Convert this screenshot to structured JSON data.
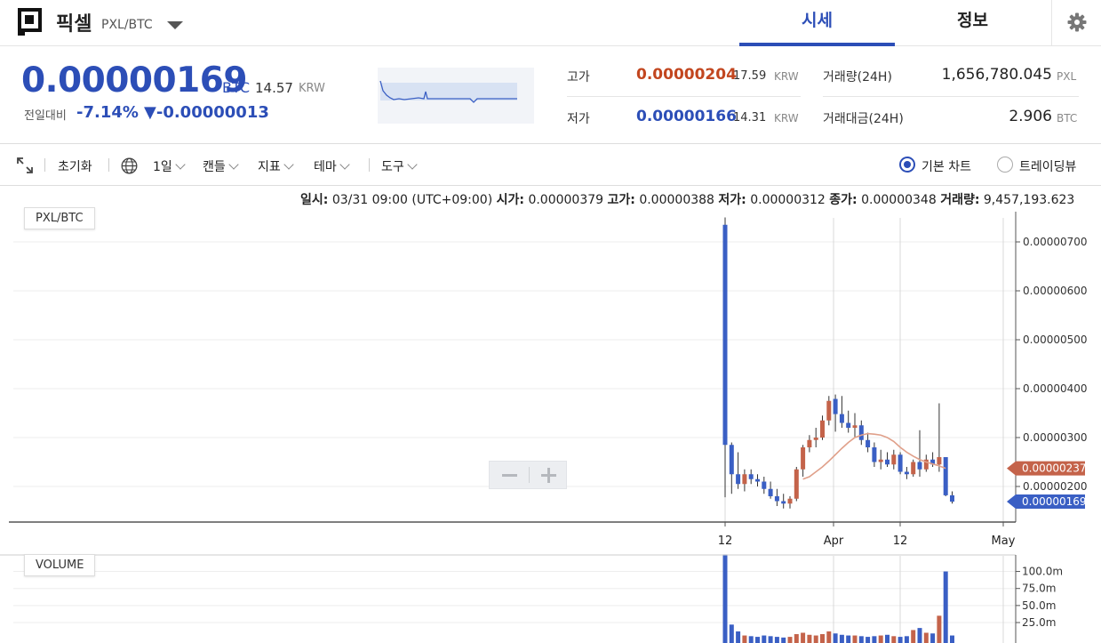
{
  "header": {
    "coin_name": "픽셀",
    "pair": "PXL/BTC",
    "tabs": [
      "시세",
      "정보"
    ]
  },
  "summary": {
    "price": "0.00000169",
    "price_unit": "BTC",
    "price_krw": "14.57",
    "krw_unit": "KRW",
    "change_label": "전일대비",
    "change_pct": "-7.14%",
    "change_abs": "▼-0.00000013",
    "high_label": "고가",
    "high_value": "0.00000204",
    "high_krw": "17.59",
    "low_label": "저가",
    "low_value": "0.00000166",
    "low_krw": "14.31",
    "volume_label": "거래량(24H)",
    "volume_value": "1,656,780.045",
    "volume_unit": "PXL",
    "amount_label": "거래대금(24H)",
    "amount_value": "2.906",
    "amount_unit": "BTC"
  },
  "toolbar": {
    "reset": "초기화",
    "interval": "1일",
    "candle": "캔들",
    "indicator": "지표",
    "theme": "테마",
    "tools": "도구",
    "basic_chart": "기본 차트",
    "tradingview": "트레이딩뷰"
  },
  "ohlc": {
    "date_label": "일시:",
    "date_value": "03/31 09:00 (UTC+09:00)",
    "open_label": "시가:",
    "open_value": "0.00000379",
    "high_label": "고가:",
    "high_value": "0.00000388",
    "low_label": "저가:",
    "low_value": "0.00000312",
    "close_label": "종가:",
    "close_value": "0.00000348",
    "volume_label": "거래량:",
    "volume_value": "9,457,193.623"
  },
  "panels": {
    "price_label": "PXL/BTC",
    "volume_label": "VOLUME"
  },
  "colors": {
    "up": "#c4634a",
    "down": "#3a5fc4",
    "accent": "#2c4eb7",
    "ma": "#e0a08a"
  },
  "chart_data": {
    "type": "candlestick",
    "y_ticks": [
      "0.00000700",
      "0.00000600",
      "0.00000500",
      "0.00000400",
      "0.00000300",
      "0.00000200"
    ],
    "x_ticks": [
      "12",
      "Apr",
      "12",
      "May"
    ],
    "ma_label": "0.00000237",
    "last_label": "0.00000169",
    "ylim": [
      1.28e-06,
      7.62e-06
    ],
    "candles": [
      [
        7.35,
        7.5,
        1.78,
        2.85
      ],
      [
        2.85,
        2.9,
        1.85,
        2.25
      ],
      [
        2.25,
        2.7,
        1.95,
        2.05
      ],
      [
        2.05,
        2.35,
        1.9,
        2.25
      ],
      [
        2.25,
        2.35,
        2.05,
        2.15
      ],
      [
        2.15,
        2.25,
        2.0,
        2.1
      ],
      [
        2.1,
        2.2,
        1.85,
        1.95
      ],
      [
        1.95,
        2.1,
        1.75,
        1.8
      ],
      [
        1.8,
        1.95,
        1.6,
        1.7
      ],
      [
        1.7,
        1.85,
        1.55,
        1.65
      ],
      [
        1.65,
        1.8,
        1.55,
        1.75
      ],
      [
        1.75,
        2.4,
        1.7,
        2.35
      ],
      [
        2.35,
        2.85,
        2.2,
        2.8
      ],
      [
        2.8,
        3.05,
        2.7,
        2.95
      ],
      [
        2.95,
        3.2,
        2.8,
        3.0
      ],
      [
        3.0,
        3.45,
        2.95,
        3.35
      ],
      [
        3.35,
        3.85,
        3.25,
        3.75
      ],
      [
        3.79,
        3.88,
        3.12,
        3.48
      ],
      [
        3.48,
        3.85,
        3.2,
        3.3
      ],
      [
        3.3,
        3.55,
        3.1,
        3.2
      ],
      [
        3.2,
        3.5,
        3.0,
        3.25
      ],
      [
        3.25,
        3.35,
        2.85,
        2.95
      ],
      [
        2.95,
        3.1,
        2.7,
        2.8
      ],
      [
        2.8,
        2.9,
        2.4,
        2.5
      ],
      [
        2.5,
        2.75,
        2.35,
        2.55
      ],
      [
        2.55,
        2.7,
        2.4,
        2.45
      ],
      [
        2.45,
        2.75,
        2.35,
        2.65
      ],
      [
        2.65,
        2.7,
        2.25,
        2.3
      ],
      [
        2.3,
        2.4,
        2.15,
        2.25
      ],
      [
        2.25,
        2.55,
        2.2,
        2.5
      ],
      [
        2.5,
        3.15,
        2.2,
        2.35
      ],
      [
        2.35,
        2.65,
        2.3,
        2.55
      ],
      [
        2.55,
        2.7,
        2.4,
        2.45
      ],
      [
        2.45,
        3.7,
        2.3,
        2.6
      ],
      [
        2.6,
        2.6,
        1.8,
        1.82
      ],
      [
        1.82,
        1.9,
        1.65,
        1.69
      ]
    ],
    "ma": [
      null,
      null,
      null,
      null,
      null,
      null,
      null,
      null,
      null,
      null,
      null,
      null,
      2.15,
      2.2,
      2.3,
      2.4,
      2.52,
      2.65,
      2.78,
      2.9,
      3.0,
      3.05,
      3.08,
      3.07,
      3.05,
      3.0,
      2.92,
      2.8,
      2.7,
      2.62,
      2.55,
      2.5,
      2.46,
      2.42,
      2.37,
      null
    ],
    "volume_ticks": [
      "100.0m",
      "75.0m",
      "50.0m",
      "25.0m"
    ],
    "volume": [
      125,
      22,
      12,
      6,
      5,
      4,
      6,
      5,
      4,
      3,
      4,
      8,
      10,
      7,
      6,
      8,
      12,
      9,
      7,
      6,
      6,
      5,
      4,
      5,
      6,
      7,
      5,
      4,
      5,
      14,
      17,
      10,
      9,
      35,
      100,
      6
    ]
  }
}
